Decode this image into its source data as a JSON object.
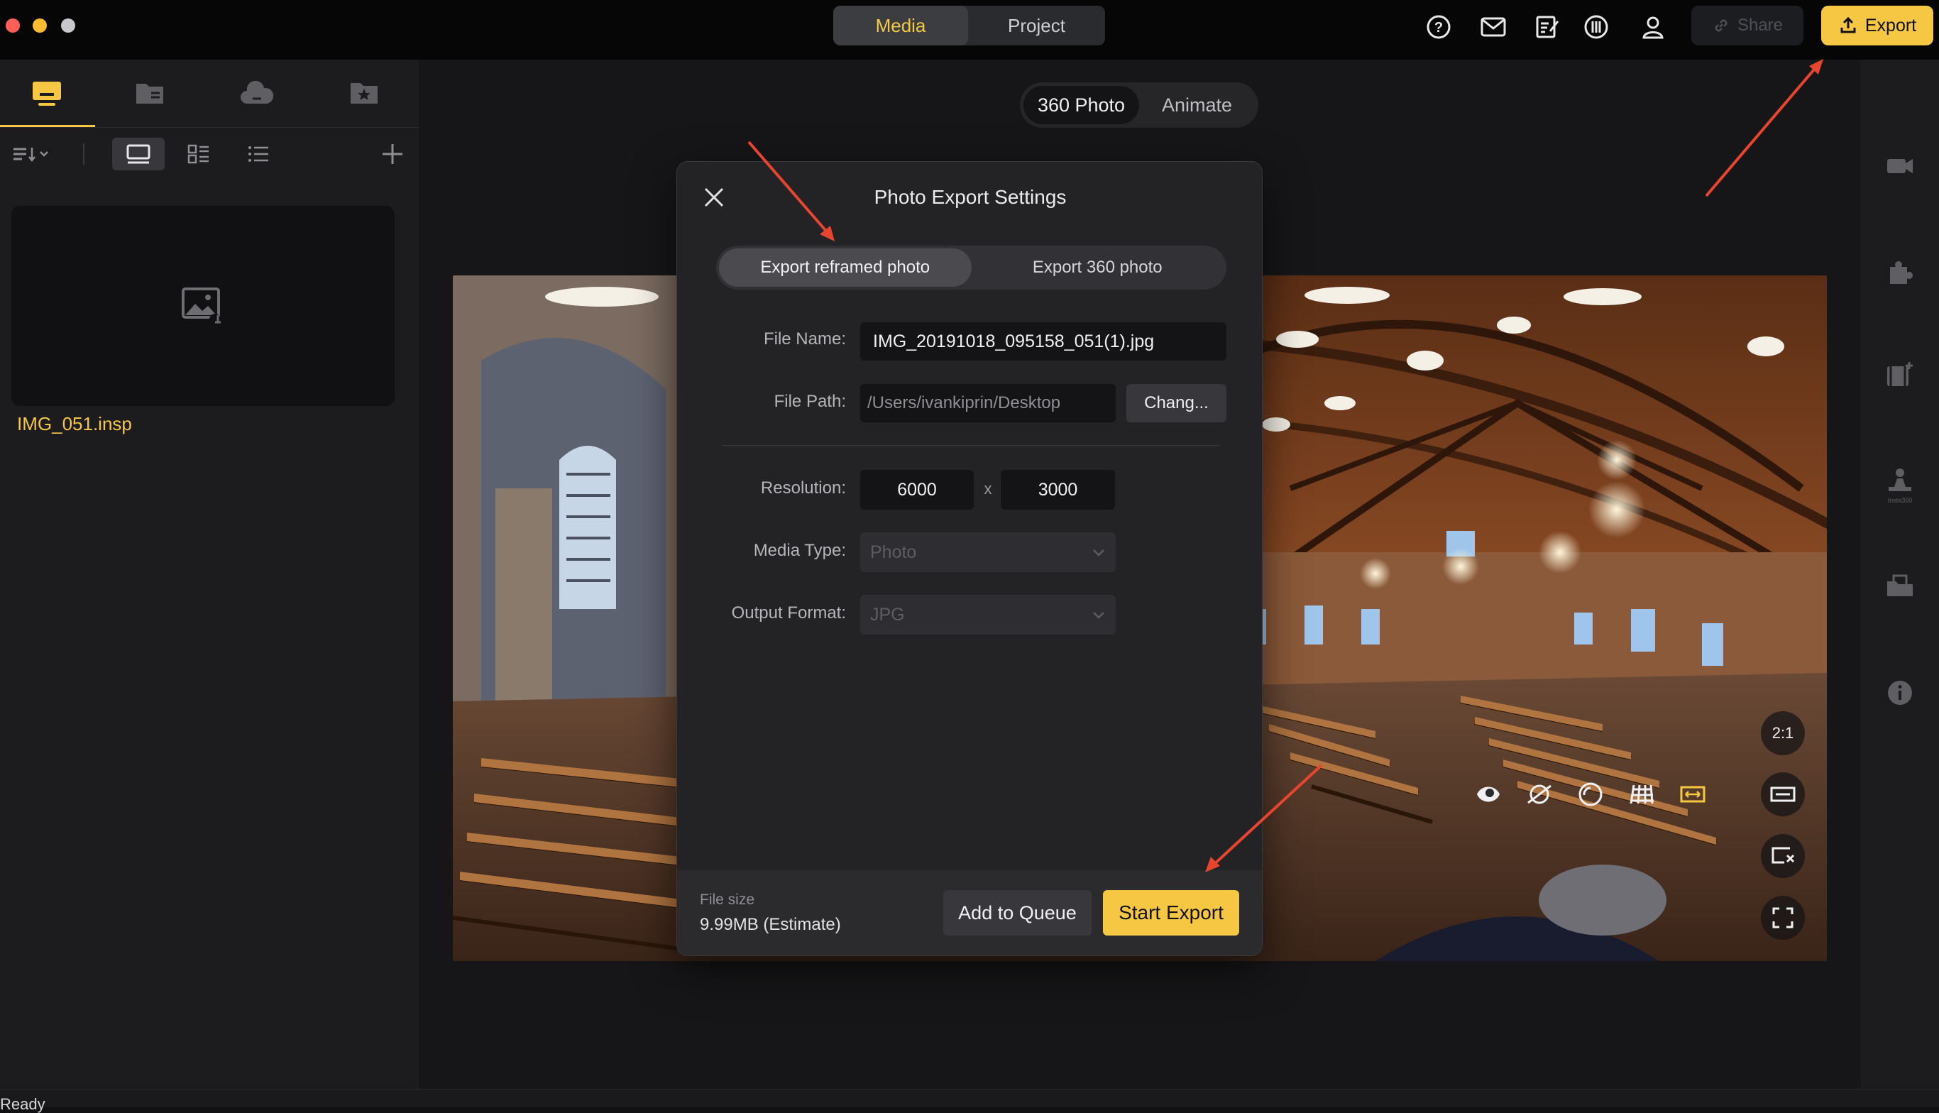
{
  "topbar": {
    "tabs": [
      {
        "label": "Media",
        "active": true
      },
      {
        "label": "Project",
        "active": false
      }
    ],
    "share_label": "Share",
    "export_label": "Export",
    "icons": [
      "help-icon",
      "mail-icon",
      "notes-icon",
      "insta360-icon",
      "user-icon"
    ]
  },
  "left_panel": {
    "tabs": [
      "local-media-icon",
      "folder-icon",
      "cloud-icon",
      "favorites-icon"
    ],
    "thumbnail": {
      "filename": "IMG_051.insp"
    }
  },
  "viewer": {
    "modes": [
      {
        "label": "360 Photo",
        "active": true
      },
      {
        "label": "Animate",
        "active": false
      }
    ],
    "aspect_ratio": "2:1"
  },
  "dialog": {
    "title": "Photo Export Settings",
    "tabs": [
      {
        "label": "Export reframed photo",
        "active": true
      },
      {
        "label": "Export 360 photo",
        "active": false
      }
    ],
    "file_name_label": "File Name:",
    "file_name": "IMG_20191018_095158_051(1).jpg",
    "file_path_label": "File Path:",
    "file_path": "/Users/ivankiprin/Desktop",
    "change_label": "Chang...",
    "resolution_label": "Resolution:",
    "resolution_width": "6000",
    "resolution_x": "x",
    "resolution_height": "3000",
    "media_type_label": "Media Type:",
    "media_type": "Photo",
    "output_format_label": "Output Format:",
    "output_format": "JPG",
    "file_size_label": "File size",
    "file_size": "9.99MB (Estimate)",
    "queue_label": "Add to Queue",
    "start_label": "Start Export"
  },
  "status": {
    "text": "Ready"
  },
  "colors": {
    "accent": "#f5c742",
    "annotation_arrow": "#e8452f",
    "background": "#111113"
  }
}
